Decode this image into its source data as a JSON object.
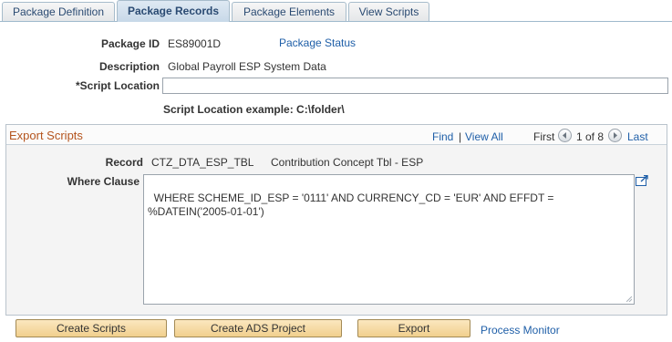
{
  "tabs": [
    {
      "label": "Package Definition",
      "active": false
    },
    {
      "label": "Package Records",
      "active": true
    },
    {
      "label": "Package Elements",
      "active": false
    },
    {
      "label": "View Scripts",
      "active": false
    }
  ],
  "header": {
    "package_id_label": "Package ID",
    "package_id_value": "ES89001D",
    "package_status_link": "Package Status",
    "description_label": "Description",
    "description_value": "Global Payroll ESP System Data",
    "script_location_label": "*Script Location",
    "script_location_value": "",
    "script_location_example": "Script Location example: C:\\folder\\"
  },
  "export_scripts": {
    "title": "Export Scripts",
    "find_link": "Find",
    "separator": "|",
    "view_all_link": "View All",
    "first_label": "First",
    "position": "1 of 8",
    "last_label": "Last",
    "record_label": "Record",
    "record_value": "CTZ_DTA_ESP_TBL",
    "record_description": "Contribution Concept Tbl - ESP",
    "where_clause_label": "Where Clause",
    "where_clause_value": "WHERE SCHEME_ID_ESP = '0111' AND CURRENCY_CD = 'EUR' AND EFFDT =\n%DATEIN('2005-01-01')"
  },
  "actions": {
    "create_scripts": "Create Scripts",
    "create_ads_project": "Create ADS Project",
    "export": "Export",
    "process_monitor": "Process Monitor"
  },
  "colors": {
    "link": "#1f5fa8",
    "section_title": "#b4541d",
    "button_bg": "#f1cf8d",
    "active_tab": "#c7d8e8"
  }
}
